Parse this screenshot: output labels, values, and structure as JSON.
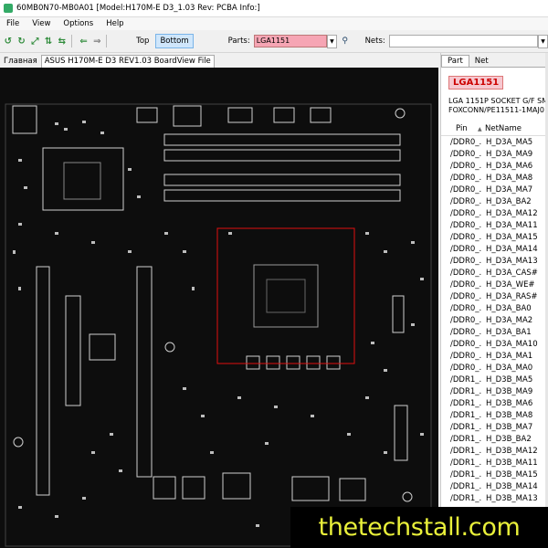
{
  "window": {
    "title": "60MB0N70-MB0A01 [Model:H170M-E D3_1.03 Rev: PCBA Info:]"
  },
  "menu": [
    "File",
    "View",
    "Options",
    "Help"
  ],
  "toolbar": {
    "top_label": "Top",
    "bottom_label": "Bottom",
    "parts_label": "Parts:",
    "parts_value": "LGA1151",
    "nets_label": "Nets:",
    "nets_value": ""
  },
  "tabs": {
    "home": "Главная",
    "file": "ASUS H170M-E D3 REV1.03 BoardView File"
  },
  "panel": {
    "tabs": [
      "Part",
      "Net"
    ],
    "part_name": "LGA1151",
    "desc_line1": "LGA 1151P SOCKET G/F SM",
    "desc_line2": "FOXCONN/PE11511-1MAJ0",
    "col_pin": "Pin",
    "col_net": "NetName",
    "rows": [
      {
        "pin": "/DDR0_...",
        "net": "H_D3A_MA5"
      },
      {
        "pin": "/DDR0_...",
        "net": "H_D3A_MA9"
      },
      {
        "pin": "/DDR0_...",
        "net": "H_D3A_MA6"
      },
      {
        "pin": "/DDR0_...",
        "net": "H_D3A_MA8"
      },
      {
        "pin": "/DDR0_...",
        "net": "H_D3A_MA7"
      },
      {
        "pin": "/DDR0_...",
        "net": "H_D3A_BA2"
      },
      {
        "pin": "/DDR0_...",
        "net": "H_D3A_MA12"
      },
      {
        "pin": "/DDR0_...",
        "net": "H_D3A_MA11"
      },
      {
        "pin": "/DDR0_...",
        "net": "H_D3A_MA15"
      },
      {
        "pin": "/DDR0_...",
        "net": "H_D3A_MA14"
      },
      {
        "pin": "/DDR0_...",
        "net": "H_D3A_MA13"
      },
      {
        "pin": "/DDR0_...",
        "net": "H_D3A_CAS#"
      },
      {
        "pin": "/DDR0_...",
        "net": "H_D3A_WE#"
      },
      {
        "pin": "/DDR0_...",
        "net": "H_D3A_RAS#"
      },
      {
        "pin": "/DDR0_...",
        "net": "H_D3A_BA0"
      },
      {
        "pin": "/DDR0_...",
        "net": "H_D3A_MA2"
      },
      {
        "pin": "/DDR0_...",
        "net": "H_D3A_BA1"
      },
      {
        "pin": "/DDR0_...",
        "net": "H_D3A_MA10"
      },
      {
        "pin": "/DDR0_...",
        "net": "H_D3A_MA1"
      },
      {
        "pin": "/DDR0_...",
        "net": "H_D3A_MA0"
      },
      {
        "pin": "/DDR1_...",
        "net": "H_D3B_MA5"
      },
      {
        "pin": "/DDR1_...",
        "net": "H_D3B_MA9"
      },
      {
        "pin": "/DDR1_...",
        "net": "H_D3B_MA6"
      },
      {
        "pin": "/DDR1_...",
        "net": "H_D3B_MA8"
      },
      {
        "pin": "/DDR1_...",
        "net": "H_D3B_MA7"
      },
      {
        "pin": "/DDR1_...",
        "net": "H_D3B_BA2"
      },
      {
        "pin": "/DDR1_...",
        "net": "H_D3B_MA12"
      },
      {
        "pin": "/DDR1_...",
        "net": "H_D3B_MA11"
      },
      {
        "pin": "/DDR1_...",
        "net": "H_D3B_MA15"
      },
      {
        "pin": "/DDR1_...",
        "net": "H_D3B_MA14"
      },
      {
        "pin": "/DDR1_...",
        "net": "H_D3B_MA13"
      }
    ]
  },
  "watermark": "thetechstall.com",
  "colors": {
    "board_bg": "#0d0d0d",
    "selection": "#e01010",
    "part_highlight": "#f6a5b4",
    "watermark": "#e9f03a"
  }
}
